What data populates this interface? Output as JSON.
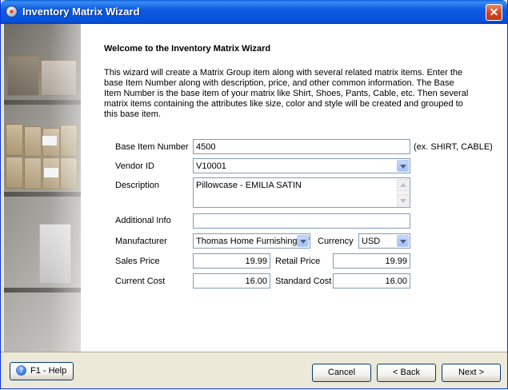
{
  "window": {
    "title": "Inventory Matrix Wizard",
    "close_glyph": "✕"
  },
  "content": {
    "heading": "Welcome to the Inventory Matrix Wizard",
    "intro": "This wizard will create a Matrix Group item along with several related matrix items.  Enter the base Item Number along with description, price, and other common information.  The Base Item Number is the base item of your matrix like Shirt, Shoes, Pants, Cable, etc.  Then several matrix items containing the attributes like size, color and style will be created and grouped to this base item."
  },
  "form": {
    "base_item_number": {
      "label": "Base Item Number",
      "value": "4500",
      "hint": "(ex. SHIRT, CABLE)"
    },
    "vendor_id": {
      "label": "Vendor ID",
      "value": "V10001"
    },
    "description": {
      "label": "Description",
      "value": "Pillowcase - EMILIA SATIN"
    },
    "additional_info": {
      "label": "Additional Info",
      "value": ""
    },
    "manufacturer": {
      "label": "Manufacturer",
      "value": "Thomas Home Furnishing Mfg"
    },
    "currency": {
      "label": "Currency",
      "value": "USD"
    },
    "sales_price": {
      "label": "Sales Price",
      "value": "19.99"
    },
    "retail_price": {
      "label": "Retail Price",
      "value": "19.99"
    },
    "current_cost": {
      "label": "Current Cost",
      "value": "16.00"
    },
    "standard_cost": {
      "label": "Standard Cost",
      "value": "16.00"
    }
  },
  "footer": {
    "help_label": "F1 -  Help",
    "help_icon_glyph": "?",
    "cancel_label": "Cancel",
    "back_label": "< Back",
    "next_label": "Next >"
  },
  "icons": [
    "app-icon",
    "close-icon",
    "help-icon",
    "chevron-down-icon",
    "scroll-up-icon",
    "scroll-down-icon"
  ]
}
